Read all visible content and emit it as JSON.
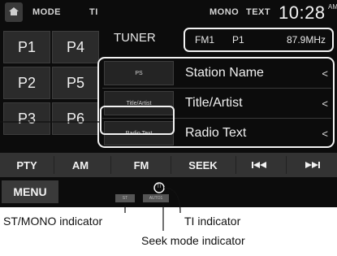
{
  "topbar": {
    "mode": "MODE",
    "ti": "TI",
    "mono": "MONO",
    "text": "TEXT",
    "time": "10:28",
    "ampm": "AM"
  },
  "presets": [
    "P1",
    "P4",
    "P2",
    "P5",
    "P3",
    "P6"
  ],
  "source": "TUNER",
  "band": {
    "band": "FM1",
    "preset": "P1",
    "frequency": "87.9MHz"
  },
  "info_rows": [
    {
      "tag": "PS",
      "value": "Station Name"
    },
    {
      "tag": "Title/Artist",
      "value": "Title/Artist"
    },
    {
      "tag": "Radio Text",
      "value": "Radio Text"
    }
  ],
  "sourcebar": {
    "pty": "PTY",
    "am": "AM",
    "fm": "FM",
    "seek": "SEEK"
  },
  "menu": "MENU",
  "indicators": {
    "st": "ST",
    "seek_mode": "AUTO1",
    "ti": "TI"
  },
  "callouts": {
    "st_mono": "ST/MONO indicator",
    "ti": "TI indicator",
    "seek_mode": "Seek mode indicator"
  }
}
